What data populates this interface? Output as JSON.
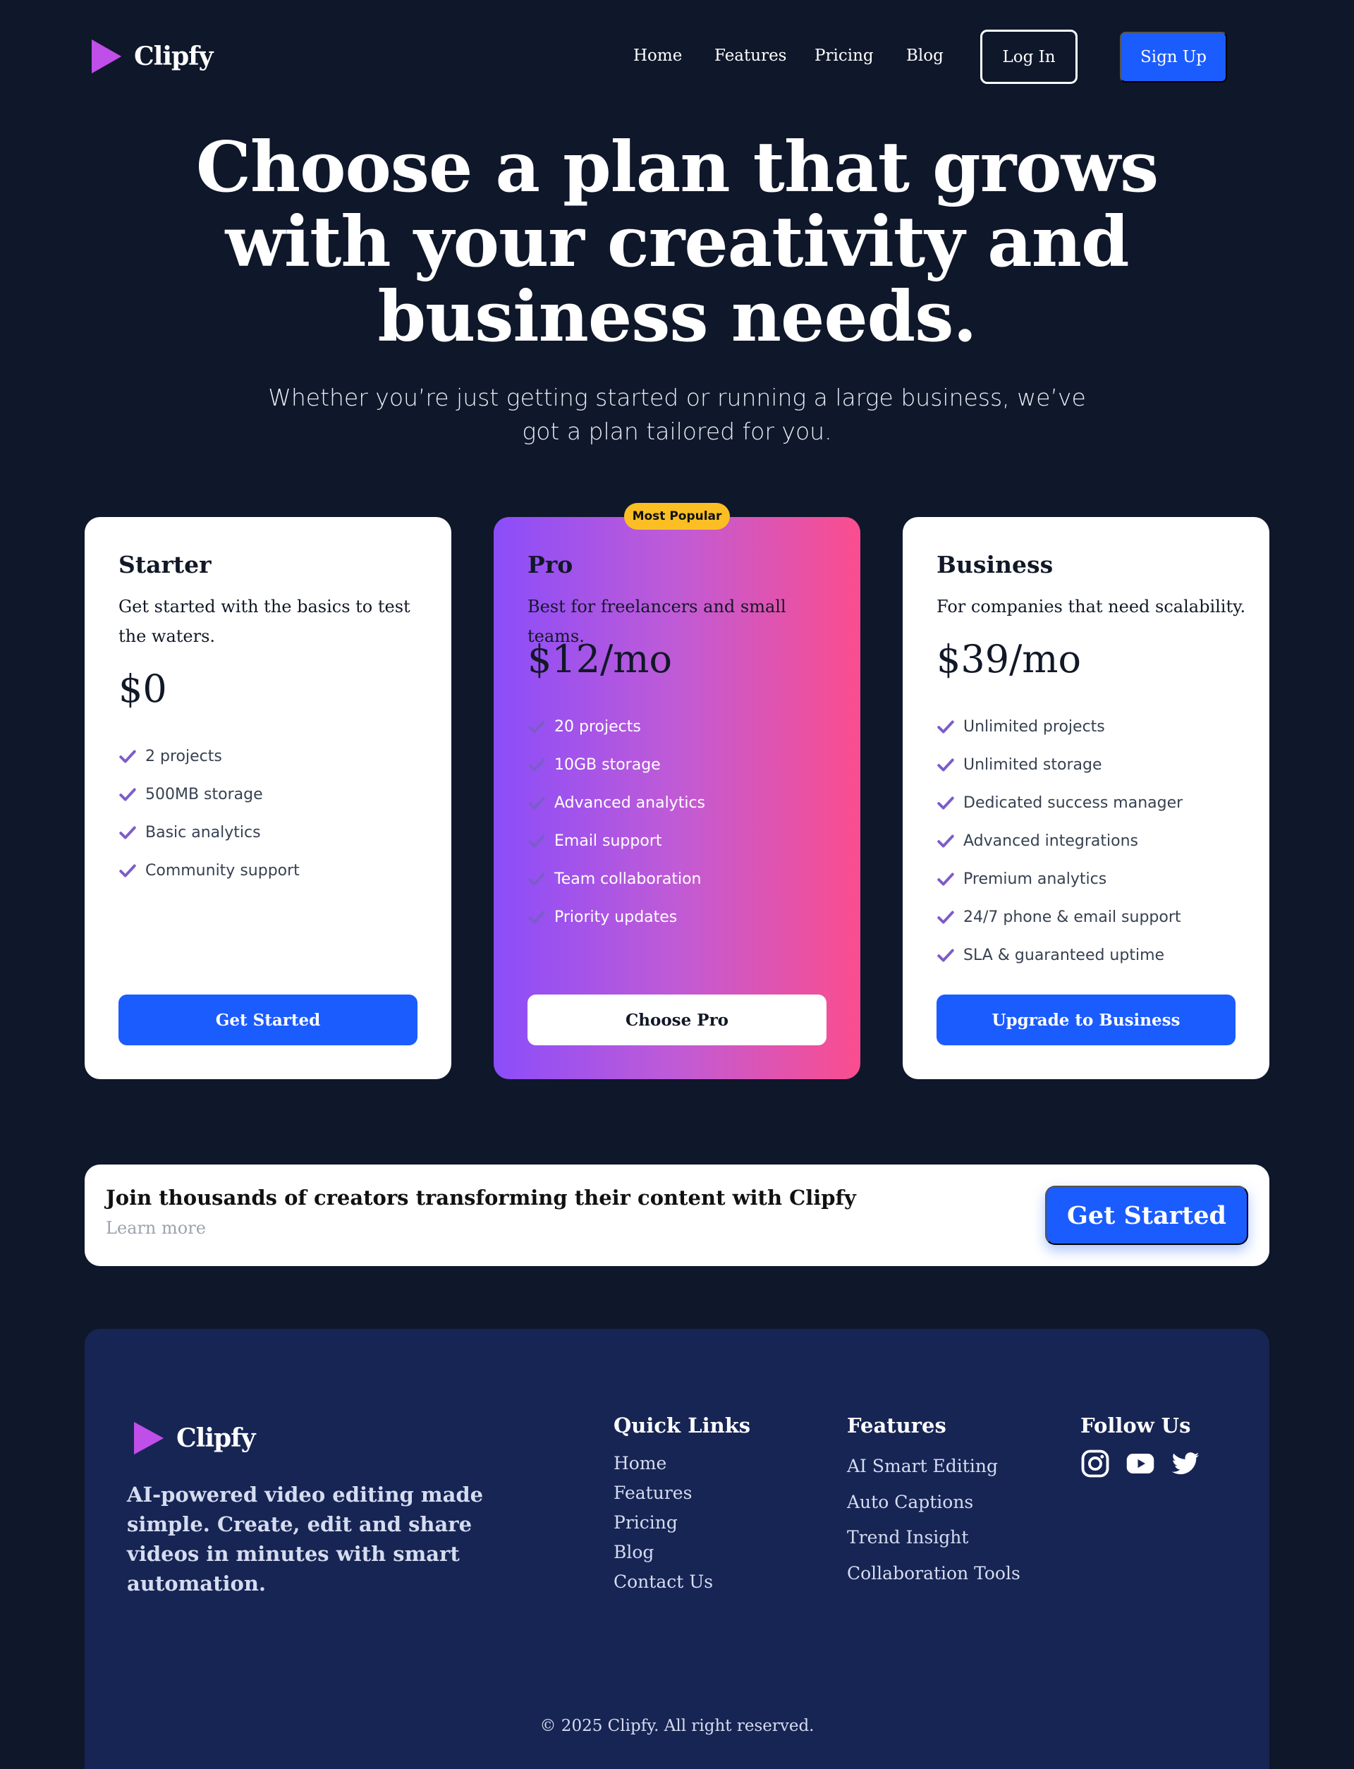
{
  "nav": {
    "brand": "Clipfy",
    "links": [
      "Home",
      "Features",
      "Pricing",
      "Blog"
    ],
    "login": "Log In",
    "signup": "Sign Up"
  },
  "hero": {
    "title": "Choose a plan that grows with your creativity and business needs.",
    "subtitle": "Whether you’re just getting started or running a large business, we’ve got a plan tailored for you."
  },
  "badge": "Most Popular",
  "plans": [
    {
      "name": "Starter",
      "description": "Get started with the basics to test the waters.",
      "price": "$0",
      "features": [
        "2 projects",
        "500MB storage",
        "Basic analytics",
        "Community support"
      ],
      "button": "Get Started"
    },
    {
      "name": "Pro",
      "description": "Best for freelancers and small teams.",
      "price": "$12/mo",
      "features": [
        "20 projects",
        "10GB storage",
        "Advanced analytics",
        "Email support",
        "Team collaboration",
        "Priority updates"
      ],
      "button": "Choose Pro"
    },
    {
      "name": "Business",
      "description": "For companies that need scalability.",
      "price": "$39/mo",
      "features": [
        "Unlimited projects",
        "Unlimited storage",
        "Dedicated success manager",
        "Advanced integrations",
        "Premium analytics",
        "24/7 phone & email support",
        "SLA & guaranteed uptime"
      ],
      "button": "Upgrade to Business"
    }
  ],
  "cta": {
    "title": "Join thousands of creators transforming their content with Clipfy",
    "link": "Learn more",
    "button": "Get Started"
  },
  "footer": {
    "brand": "Clipfy",
    "tagline": "AI-powered video editing made simple. Create, edit and share videos in minutes with smart automation.",
    "quick_links_title": "Quick Links",
    "quick_links": [
      "Home",
      "Features",
      "Pricing",
      "Blog",
      "Contact Us"
    ],
    "features_title": "Features",
    "features": [
      "AI Smart Editing",
      "Auto Captions",
      "Trend Insight",
      "Collaboration Tools"
    ],
    "follow_title": "Follow Us",
    "social_icons": [
      "instagram-icon",
      "youtube-icon",
      "twitter-icon"
    ],
    "copyright": "© 2025 Clipfy. All right reserved."
  },
  "colors": {
    "background": "#0f172a",
    "primary_blue": "#1b5cff",
    "pro_gradient_start": "#8b4dfa",
    "pro_gradient_end": "#fb4d8e",
    "badge": "#fbbf24",
    "footer": "#172554",
    "check": "#7c5cc9"
  }
}
